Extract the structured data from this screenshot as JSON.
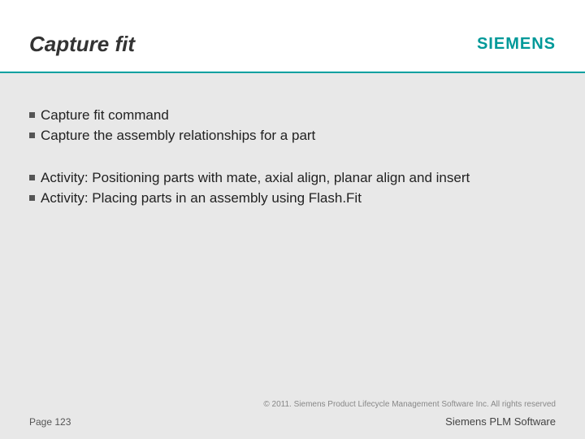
{
  "header": {
    "title": "Capture fit",
    "logo": "SIEMENS"
  },
  "content": {
    "group1": {
      "item1": "Capture fit command",
      "item2": "Capture the assembly relationships for a part"
    },
    "group2": {
      "item1": "Activity: Positioning parts with mate, axial align, planar align and insert",
      "item2": "Activity: Placing parts in an assembly using Flash.Fit"
    }
  },
  "footer": {
    "copyright": "© 2011. Siemens Product Lifecycle Management Software Inc. All rights reserved",
    "page": "Page 123",
    "brand": "Siemens PLM Software"
  }
}
